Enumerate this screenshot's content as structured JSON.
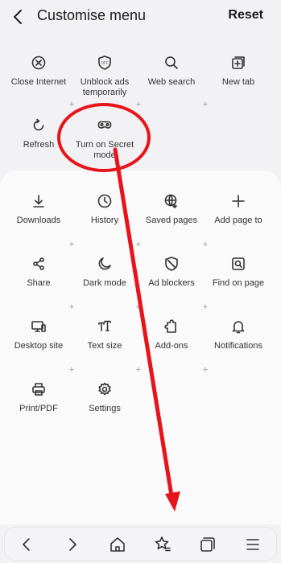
{
  "header": {
    "title": "Customise menu",
    "reset_label": "Reset"
  },
  "top_items": [
    {
      "label": "Close Internet",
      "icon": "close-circle-icon"
    },
    {
      "label": "Unblock ads temporarily",
      "icon": "ad-shield-icon",
      "badge": "OFF"
    },
    {
      "label": "Web search",
      "icon": "search-icon"
    },
    {
      "label": "New tab",
      "icon": "new-tab-icon"
    },
    {
      "label": "Refresh",
      "icon": "refresh-icon"
    },
    {
      "label": "Turn on Secret mode",
      "icon": "secret-mode-mask-icon"
    }
  ],
  "panel_items": [
    {
      "label": "Downloads",
      "icon": "download-icon"
    },
    {
      "label": "History",
      "icon": "clock-icon"
    },
    {
      "label": "Saved pages",
      "icon": "saved-pages-globe-icon"
    },
    {
      "label": "Add page to",
      "icon": "plus-icon"
    },
    {
      "label": "Share",
      "icon": "share-icon"
    },
    {
      "label": "Dark mode",
      "icon": "moon-icon"
    },
    {
      "label": "Ad blockers",
      "icon": "shield-slash-icon"
    },
    {
      "label": "Find on page",
      "icon": "find-on-page-icon"
    },
    {
      "label": "Desktop site",
      "icon": "desktop-icon"
    },
    {
      "label": "Text size",
      "icon": "text-size-icon"
    },
    {
      "label": "Add-ons",
      "icon": "puzzle-icon"
    },
    {
      "label": "Notifications",
      "icon": "bell-icon"
    },
    {
      "label": "Print/PDF",
      "icon": "printer-icon"
    },
    {
      "label": "Settings",
      "icon": "gear-icon"
    }
  ],
  "bottom_nav": [
    {
      "name": "back-nav-button",
      "icon": "chevron-left-icon"
    },
    {
      "name": "forward-nav-button",
      "icon": "chevron-right-icon"
    },
    {
      "name": "home-button",
      "icon": "home-icon"
    },
    {
      "name": "bookmarks-button",
      "icon": "star-list-icon"
    },
    {
      "name": "tabs-button",
      "icon": "tabs-icon"
    },
    {
      "name": "menu-button",
      "icon": "hamburger-menu-icon"
    }
  ],
  "annotation": {
    "color": "#e8141b"
  }
}
